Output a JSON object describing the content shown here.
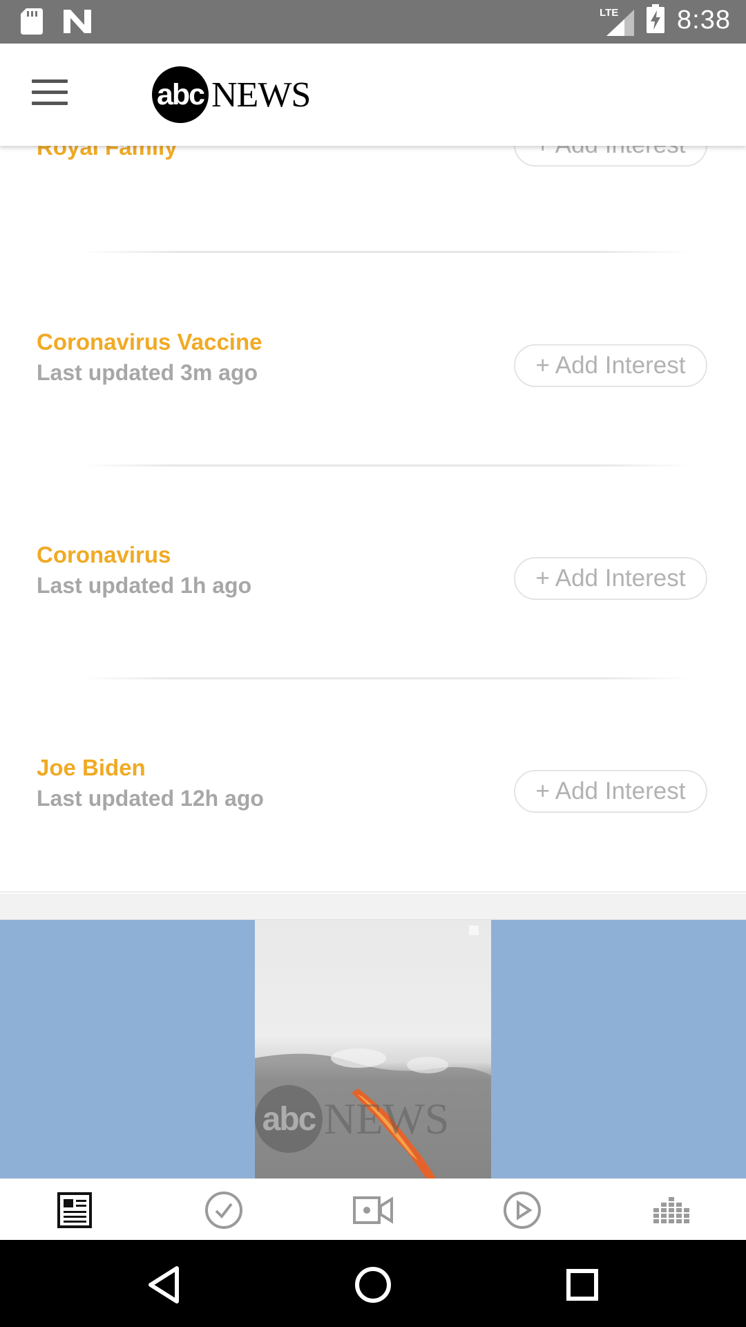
{
  "status_bar": {
    "time": "8:38",
    "network": "LTE",
    "icons": [
      "sd-card-icon",
      "n-notification-icon",
      "lte-signal-icon",
      "battery-charging-icon"
    ]
  },
  "header": {
    "menu_icon": "hamburger-menu-icon",
    "logo_abc": "abc",
    "logo_news": "NEWS"
  },
  "interests": [
    {
      "title": "Royal Family",
      "subtitle": "",
      "button_label": "+ Add Interest"
    },
    {
      "title": "Coronavirus Vaccine",
      "subtitle": "Last updated 3m ago",
      "button_label": "+ Add Interest"
    },
    {
      "title": "Coronavirus",
      "subtitle": "Last updated 1h ago",
      "button_label": "+ Add Interest"
    },
    {
      "title": "Joe Biden",
      "subtitle": "Last updated 12h ago",
      "button_label": "+ Add Interest"
    }
  ],
  "video": {
    "watermark_abc": "abc",
    "watermark_news": "NEWS"
  },
  "bottom_nav": [
    {
      "icon": "news-feed-icon",
      "active": true
    },
    {
      "icon": "check-circle-icon",
      "active": false
    },
    {
      "icon": "video-camera-icon",
      "active": false
    },
    {
      "icon": "play-circle-icon",
      "active": false
    },
    {
      "icon": "audio-bars-icon",
      "active": false
    }
  ],
  "system_nav": [
    "back-icon",
    "home-icon",
    "recents-icon"
  ],
  "colors": {
    "accent": "#f0aa24",
    "subtitle": "#a7a7a7",
    "status_bar": "#757575",
    "video_bg": "#8fb0d6"
  }
}
